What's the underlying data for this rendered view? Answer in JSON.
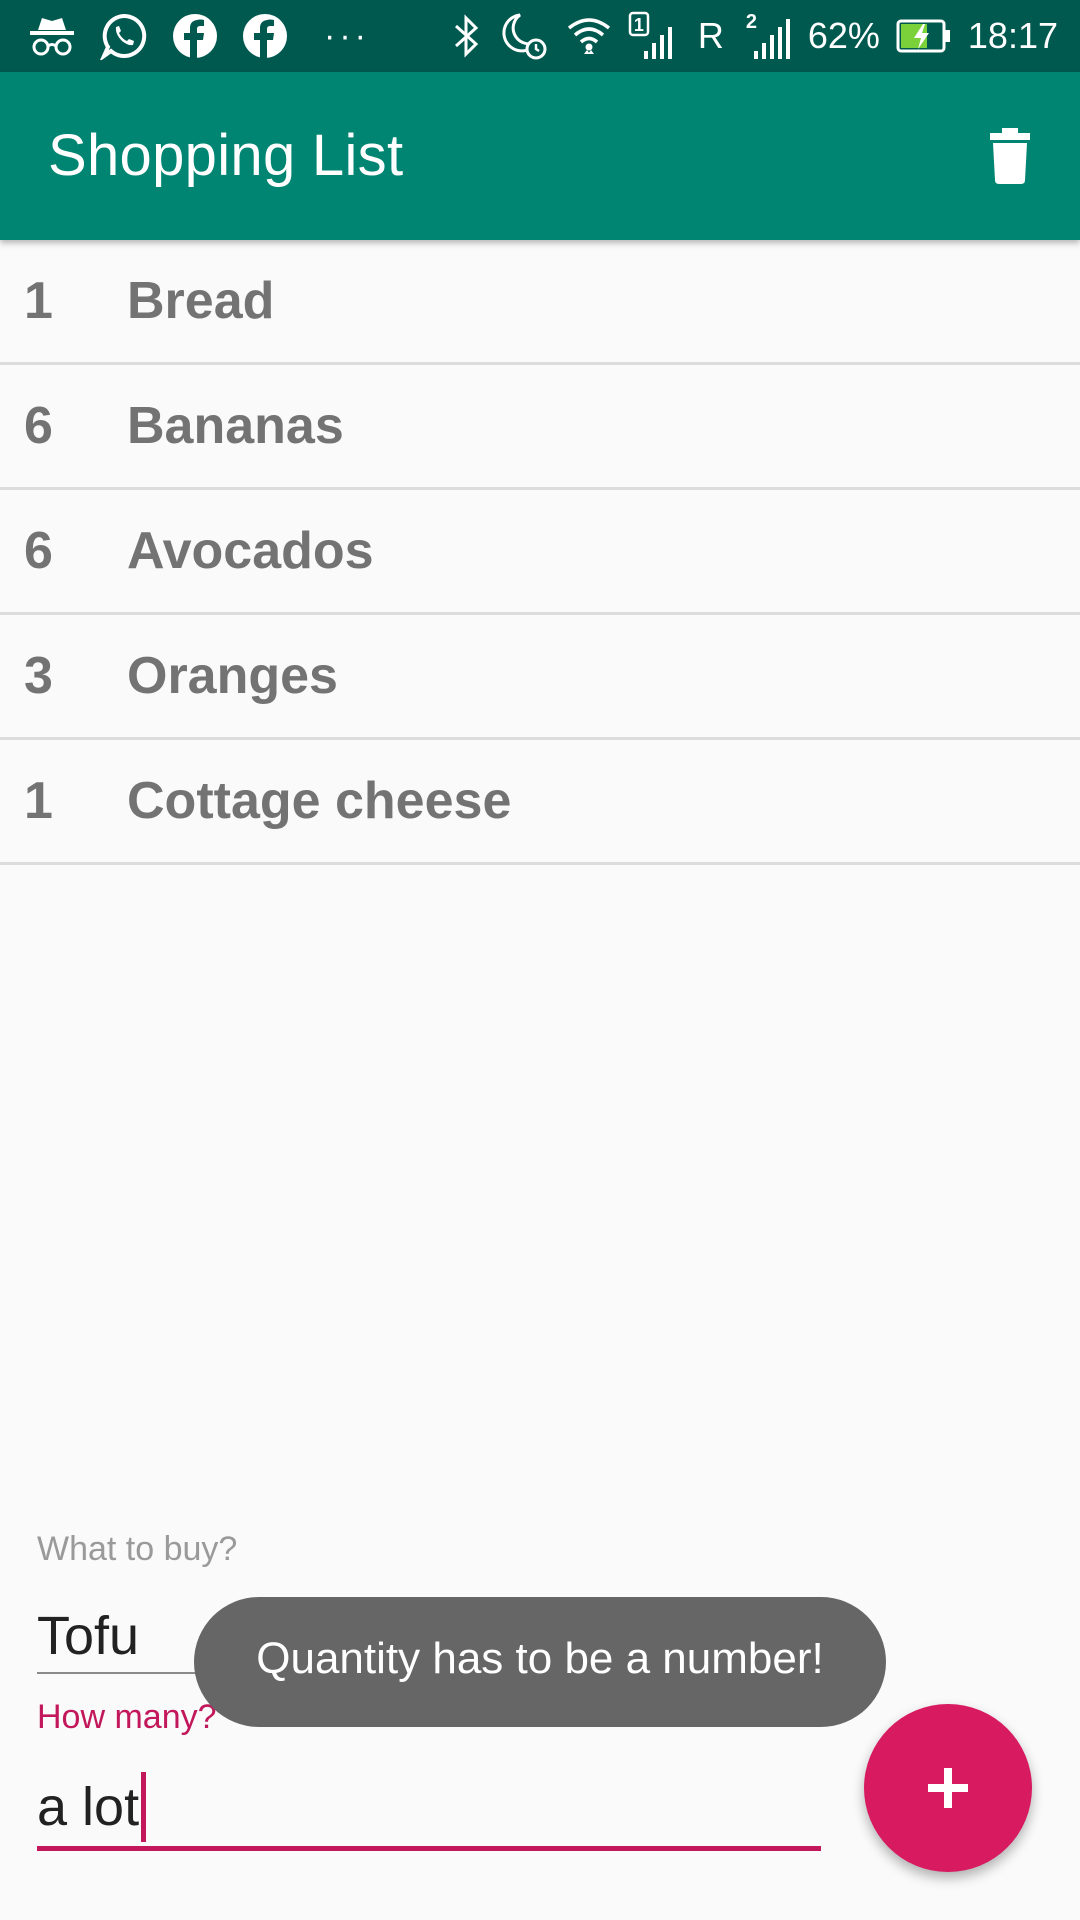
{
  "status_bar": {
    "icons": [
      "incognito-icon",
      "whatsapp-icon",
      "facebook-icon",
      "facebook-icon",
      "more-dots-icon",
      "bluetooth-icon",
      "do-not-disturb-alarm-icon",
      "wifi-icon",
      "signal-sim1-icon",
      "signal-sim2-icon",
      "battery-charging-icon"
    ],
    "dots": "···",
    "roaming": "R",
    "sim1_label": "1",
    "sim2_label": "2",
    "battery": "62%",
    "time": "18:17"
  },
  "app_bar": {
    "title": "Shopping List",
    "delete_icon": "trash-icon",
    "color": "#018573"
  },
  "items": [
    {
      "qty": "1",
      "name": "Bread"
    },
    {
      "qty": "6",
      "name": "Bananas"
    },
    {
      "qty": "6",
      "name": "Avocados"
    },
    {
      "qty": "3",
      "name": "Oranges"
    },
    {
      "qty": "1",
      "name": "Cottage cheese"
    }
  ],
  "form": {
    "what_label": "What to buy?",
    "what_value": "Tofu",
    "many_label": "How many?",
    "many_value": "a lot"
  },
  "toast": {
    "message": "Quantity has to be a number!"
  },
  "fab": {
    "icon": "plus-icon",
    "color": "#d81b60"
  },
  "colors": {
    "status_bar": "#00594f",
    "accent": "#c2185b",
    "list_text": "#737373"
  }
}
